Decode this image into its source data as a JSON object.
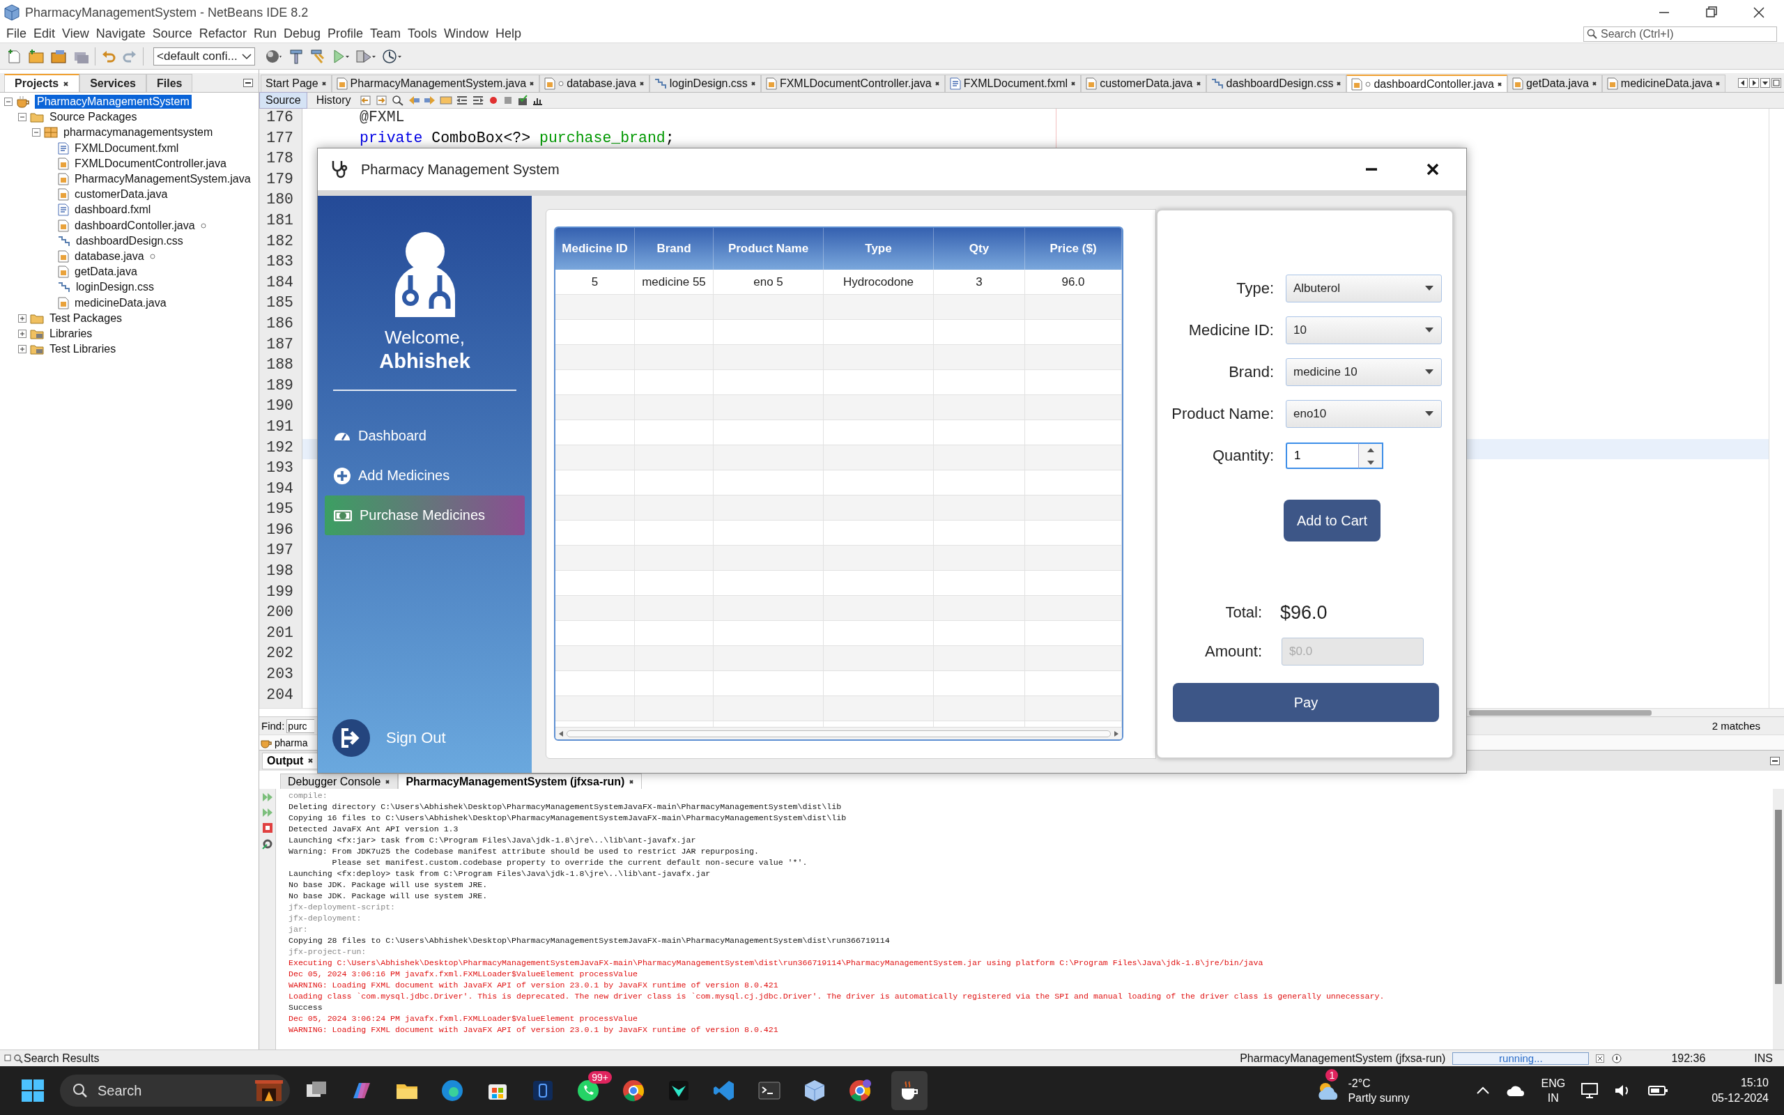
{
  "window": {
    "title": "PharmacyManagementSystem - NetBeans IDE 8.2"
  },
  "menu": [
    "File",
    "Edit",
    "View",
    "Navigate",
    "Source",
    "Refactor",
    "Run",
    "Debug",
    "Profile",
    "Team",
    "Tools",
    "Window",
    "Help"
  ],
  "search": {
    "placeholder": "Search (Ctrl+I)"
  },
  "toolbar": {
    "configuration": "<default confi..."
  },
  "projects_panel": {
    "tabs": [
      {
        "label": "Projects",
        "selected": true
      },
      {
        "label": "Services",
        "selected": false
      },
      {
        "label": "Files",
        "selected": false
      }
    ],
    "tree": [
      {
        "label": "PharmacyManagementSystem",
        "kind": "project",
        "selected": true,
        "expanded": true,
        "children": [
          {
            "label": "Source Packages",
            "kind": "folder",
            "selected": false,
            "expanded": true,
            "children": [
              {
                "label": "pharmacymanagementsystem",
                "kind": "package",
                "selected": false,
                "expanded": true,
                "children": [
                  {
                    "label": "FXMLDocument.fxml",
                    "kind": "fxml",
                    "selected": false,
                    "modified": false
                  },
                  {
                    "label": "FXMLDocumentController.java",
                    "kind": "java",
                    "selected": false,
                    "modified": false
                  },
                  {
                    "label": "PharmacyManagementSystem.java",
                    "kind": "java",
                    "selected": false,
                    "modified": false
                  },
                  {
                    "label": "customerData.java",
                    "kind": "java",
                    "selected": false,
                    "modified": false
                  },
                  {
                    "label": "dashboard.fxml",
                    "kind": "fxml",
                    "selected": false,
                    "modified": false
                  },
                  {
                    "label": "dashboardContoller.java",
                    "kind": "java",
                    "selected": false,
                    "modified": true
                  },
                  {
                    "label": "dashboardDesign.css",
                    "kind": "css",
                    "selected": false,
                    "modified": false
                  },
                  {
                    "label": "database.java",
                    "kind": "java",
                    "selected": false,
                    "modified": true
                  },
                  {
                    "label": "getData.java",
                    "kind": "java",
                    "selected": false,
                    "modified": false
                  },
                  {
                    "label": "loginDesign.css",
                    "kind": "css",
                    "selected": false,
                    "modified": false
                  },
                  {
                    "label": "medicineData.java",
                    "kind": "java",
                    "selected": false,
                    "modified": false
                  }
                ]
              }
            ]
          },
          {
            "label": "Test Packages",
            "kind": "folder",
            "selected": false,
            "expanded": false
          },
          {
            "label": "Libraries",
            "kind": "library",
            "selected": false,
            "expanded": false
          },
          {
            "label": "Test Libraries",
            "kind": "library",
            "selected": false,
            "expanded": false
          }
        ]
      }
    ]
  },
  "editor": {
    "tabs": [
      {
        "label": "Start Page",
        "kind": "page",
        "selected": false,
        "modified": false
      },
      {
        "label": "PharmacyManagementSystem.java",
        "kind": "java",
        "selected": false,
        "modified": false
      },
      {
        "label": "database.java",
        "kind": "java",
        "selected": false,
        "modified": true
      },
      {
        "label": "loginDesign.css",
        "kind": "css",
        "selected": false,
        "modified": false
      },
      {
        "label": "FXMLDocumentController.java",
        "kind": "java",
        "selected": false,
        "modified": false
      },
      {
        "label": "FXMLDocument.fxml",
        "kind": "fxml",
        "selected": false,
        "modified": false
      },
      {
        "label": "customerData.java",
        "kind": "java",
        "selected": false,
        "modified": false
      },
      {
        "label": "dashboardDesign.css",
        "kind": "css",
        "selected": false,
        "modified": false
      },
      {
        "label": "dashboardContoller.java",
        "kind": "java",
        "selected": true,
        "modified": true
      },
      {
        "label": "getData.java",
        "kind": "java",
        "selected": false,
        "modified": false
      },
      {
        "label": "medicineData.java",
        "kind": "java",
        "selected": false,
        "modified": false
      }
    ],
    "views": [
      {
        "label": "Source",
        "selected": true
      },
      {
        "label": "History",
        "selected": false
      }
    ],
    "lines": [
      {
        "number": "176",
        "current": false,
        "tokens": [
          {
            "text": "@FXML",
            "kind": "annotation"
          }
        ]
      },
      {
        "number": "177",
        "current": false,
        "tokens": [
          {
            "text": "private",
            "kind": "keyword"
          },
          {
            "text": " ComboBox<?> ",
            "kind": "plain"
          },
          {
            "text": "purchase_brand",
            "kind": "field"
          },
          {
            "text": ";",
            "kind": "plain"
          }
        ]
      },
      {
        "number": "178",
        "current": false
      },
      {
        "number": "179",
        "current": false
      },
      {
        "number": "180",
        "current": false
      },
      {
        "number": "181",
        "current": false
      },
      {
        "number": "182",
        "current": false
      },
      {
        "number": "183",
        "current": false
      },
      {
        "number": "184",
        "current": false
      },
      {
        "number": "185",
        "current": false
      },
      {
        "number": "186",
        "current": false
      },
      {
        "number": "187",
        "current": false
      },
      {
        "number": "188",
        "current": false
      },
      {
        "number": "189",
        "current": false
      },
      {
        "number": "190",
        "current": false
      },
      {
        "number": "191",
        "current": false
      },
      {
        "number": "192",
        "current": true
      },
      {
        "number": "193",
        "current": false
      },
      {
        "number": "194",
        "current": false
      },
      {
        "number": "195",
        "current": false
      },
      {
        "number": "196",
        "current": false
      },
      {
        "number": "197",
        "current": false
      },
      {
        "number": "198",
        "current": false
      },
      {
        "number": "199",
        "current": false
      },
      {
        "number": "200",
        "current": false
      },
      {
        "number": "201",
        "current": false
      },
      {
        "number": "202",
        "current": false
      },
      {
        "number": "203",
        "current": false
      },
      {
        "number": "204",
        "current": false
      }
    ],
    "find": {
      "label": "Find:",
      "value": "purc",
      "matches": "2 matches"
    },
    "navigator": "pharma"
  },
  "output": {
    "title": "Output",
    "tabs": [
      {
        "label": "Debugger Console",
        "selected": false
      },
      {
        "label": "PharmacyManagementSystem (jfxsa-run)",
        "selected": true
      }
    ],
    "lines": [
      {
        "text": "compile:",
        "kind": "target"
      },
      {
        "text": "Deleting directory C:\\Users\\Abhishek\\Desktop\\PharmacyManagementSystemJavaFX-main\\PharmacyManagementSystem\\dist\\lib",
        "kind": "info"
      },
      {
        "text": "Copying 16 files to C:\\Users\\Abhishek\\Desktop\\PharmacyManagementSystemJavaFX-main\\PharmacyManagementSystem\\dist\\lib",
        "kind": "info"
      },
      {
        "text": "Detected JavaFX Ant API version 1.3",
        "kind": "info"
      },
      {
        "text": "Launching <fx:jar> task from C:\\Program Files\\Java\\jdk-1.8\\jre\\..\\lib\\ant-javafx.jar",
        "kind": "info"
      },
      {
        "text": "Warning: From JDK7u25 the Codebase manifest attribute should be used to restrict JAR repurposing.",
        "kind": "info"
      },
      {
        "text": "         Please set manifest.custom.codebase property to override the current default non-secure value '*'.",
        "kind": "info"
      },
      {
        "text": "Launching <fx:deploy> task from C:\\Program Files\\Java\\jdk-1.8\\jre\\..\\lib\\ant-javafx.jar",
        "kind": "info"
      },
      {
        "text": "No base JDK. Package will use system JRE.",
        "kind": "info"
      },
      {
        "text": "No base JDK. Package will use system JRE.",
        "kind": "info"
      },
      {
        "text": "jfx-deployment-script:",
        "kind": "target"
      },
      {
        "text": "jfx-deployment:",
        "kind": "target"
      },
      {
        "text": "jar:",
        "kind": "target"
      },
      {
        "text": "Copying 28 files to C:\\Users\\Abhishek\\Desktop\\PharmacyManagementSystemJavaFX-main\\PharmacyManagementSystem\\dist\\run366719114",
        "kind": "info"
      },
      {
        "text": "jfx-project-run:",
        "kind": "target"
      },
      {
        "text": "Executing C:\\Users\\Abhishek\\Desktop\\PharmacyManagementSystemJavaFX-main\\PharmacyManagementSystem\\dist\\run366719114\\PharmacyManagementSystem.jar using platform C:\\Program Files\\Java\\jdk-1.8\\jre/bin/java",
        "kind": "error"
      },
      {
        "text": "Dec 05, 2024 3:06:16 PM javafx.fxml.FXMLLoader$ValueElement processValue",
        "kind": "error"
      },
      {
        "text": "WARNING: Loading FXML document with JavaFX API of version 23.0.1 by JavaFX runtime of version 8.0.421",
        "kind": "error"
      },
      {
        "text": "Loading class `com.mysql.jdbc.Driver'. This is deprecated. The new driver class is `com.mysql.cj.jdbc.Driver'. The driver is automatically registered via the SPI and manual loading of the driver class is generally unnecessary.",
        "kind": "error"
      },
      {
        "text": "Success",
        "kind": "info"
      },
      {
        "text": "Dec 05, 2024 3:06:24 PM javafx.fxml.FXMLLoader$ValueElement processValue",
        "kind": "error"
      },
      {
        "text": "WARNING: Loading FXML document with JavaFX API of version 23.0.1 by JavaFX runtime of version 8.0.421",
        "kind": "error"
      }
    ]
  },
  "status_bar": {
    "search_results": "Search Results",
    "run_task": "PharmacyManagementSystem (jfxsa-run)",
    "progress": "running...",
    "position": "192:36",
    "mode": "INS"
  },
  "dialog": {
    "title": "Pharmacy Management System",
    "sidebar": {
      "welcome": "Welcome,",
      "user": "Abhishek",
      "nav": [
        {
          "label": "Dashboard",
          "kind": "dashboard",
          "selected": false
        },
        {
          "label": "Add Medicines",
          "kind": "add",
          "selected": false
        },
        {
          "label": "Purchase Medicines",
          "kind": "purchase",
          "selected": true
        }
      ],
      "sign_out": "Sign Out"
    },
    "table": {
      "columns": [
        "Medicine ID",
        "Brand",
        "Product Name",
        "Type",
        "Qty",
        "Price ($)"
      ],
      "rows": [
        [
          "5",
          "medicine 55",
          "eno 5",
          "Hydrocodone",
          "3",
          "96.0"
        ]
      ]
    },
    "form": {
      "fields": [
        {
          "label": "Type:",
          "kind": "combo",
          "value": "Albuterol"
        },
        {
          "label": "Medicine ID:",
          "kind": "combo",
          "value": "10"
        },
        {
          "label": "Brand:",
          "kind": "combo",
          "value": "medicine 10"
        },
        {
          "label": "Product Name:",
          "kind": "combo",
          "value": "eno10"
        },
        {
          "label": "Quantity:",
          "kind": "spinner",
          "value": "1"
        }
      ],
      "add_button": "Add to Cart",
      "total_label": "Total:",
      "total": "$96.0",
      "amount_label": "Amount:",
      "amount_placeholder": "$0.0",
      "pay_button": "Pay"
    }
  },
  "taskbar": {
    "search": "Search",
    "chat_badge": "99+",
    "weather_badge": "1",
    "temperature": "-2°C",
    "weather": "Partly sunny",
    "language": "ENG",
    "region": "IN",
    "time": "15:10",
    "date": "05-12-2024"
  }
}
